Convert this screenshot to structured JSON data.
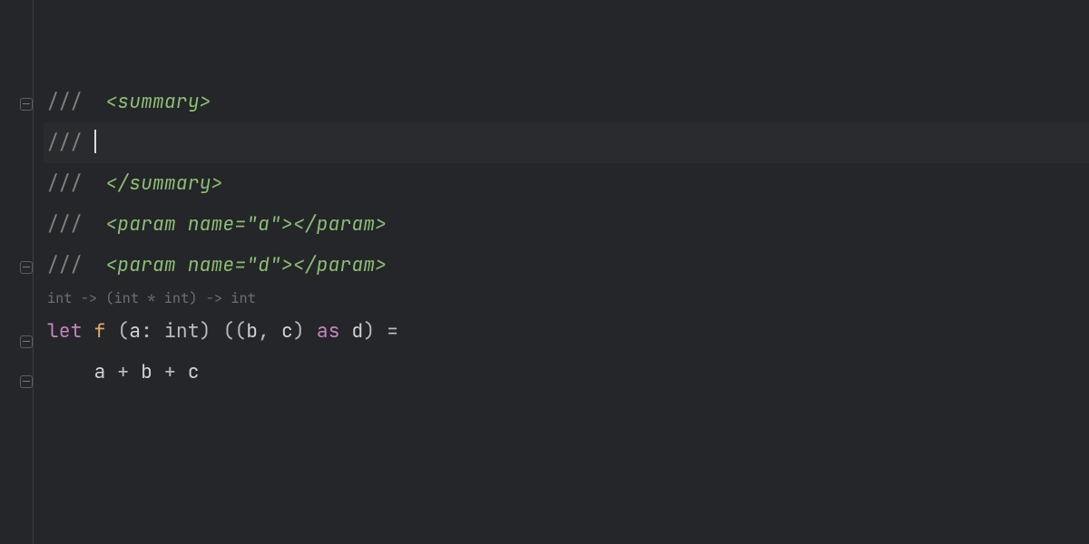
{
  "editor": {
    "cursor_line": 1,
    "type_hint": "int -> (int * int) -> int",
    "lines": [
      {
        "slash": "///",
        "angle_open": "<",
        "tag": "summary",
        "angle_close": ">",
        "full_open": "<summary>"
      },
      {
        "slash": "///"
      },
      {
        "slash": "///",
        "angle_open": "</",
        "tag": "summary",
        "angle_close": ">",
        "full_close": "</summary>"
      },
      {
        "slash": "///",
        "open": "<param name=\"a\">",
        "close": "</param>",
        "open_angle": "<",
        "tag": "param",
        "attr_name": "name",
        "attr_eq": "=",
        "attr_val": "\"a\"",
        "close_angle": "></",
        "tag2": "param",
        "end_angle": ">"
      },
      {
        "slash": "///",
        "open_angle": "<",
        "tag": "param",
        "attr_name": "name",
        "attr_eq": "=",
        "attr_val": "\"d\"",
        "close_angle": "></",
        "tag2": "param",
        "end_angle": ">"
      },
      {
        "kw_let": "let",
        "fn": "f",
        "p1_open": "(",
        "p1_var": "a",
        "p1_colon": ":",
        "p1_type": "int",
        "p1_close": ")",
        "p2_open1": "(",
        "p2_open2": "(",
        "p2_b": "b",
        "p2_comma": ",",
        "p2_c": "c",
        "p2_close1": ")",
        "p2_as": "as",
        "p2_d": "d",
        "p2_close2": ")",
        "eq": "="
      },
      {
        "indent": "    ",
        "body_a": "a",
        "plus1": "+",
        "body_b": "b",
        "plus2": "+",
        "body_c": "c"
      }
    ]
  }
}
